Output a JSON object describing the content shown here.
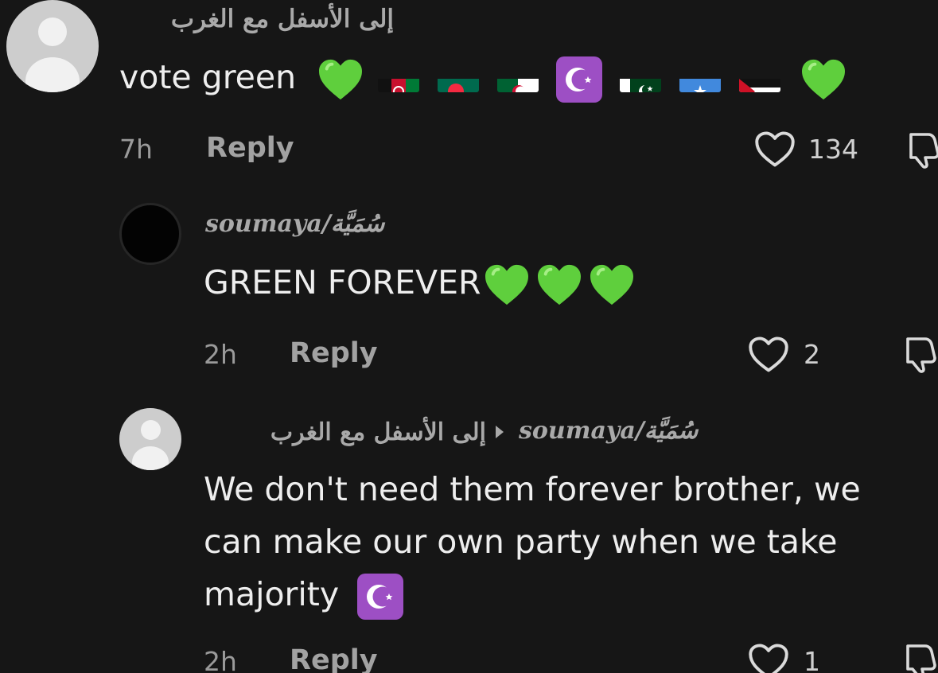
{
  "comments": [
    {
      "username": "إلى الأسفل مع الغرب",
      "text": "vote green",
      "time": "7h",
      "reply_label": "Reply",
      "likes": "134"
    },
    {
      "username": "soumaya/سُمَيَّة",
      "text": "GREEN FOREVER",
      "time": "2h",
      "reply_label": "Reply",
      "likes": "2"
    },
    {
      "username": "إلى الأسفل مع الغرب",
      "reply_to": "soumaya/سُمَيَّة",
      "text_line1": "We don't need them forever brother, we",
      "text_line2": "can make our own party when we take",
      "text_line3": "majority",
      "time": "2h",
      "reply_label": "Reply",
      "likes": "1"
    }
  ],
  "emoji_names": [
    "green-heart-icon",
    "afghanistan-flag-icon",
    "bangladesh-flag-icon",
    "algeria-flag-icon",
    "star-and-crescent-icon",
    "pakistan-flag-icon",
    "somalia-flag-icon",
    "palestine-flag-icon"
  ],
  "colors": {
    "background": "#161616",
    "green_heart": "#5fcf3d",
    "crescent_purple": "#9d4fc4"
  }
}
